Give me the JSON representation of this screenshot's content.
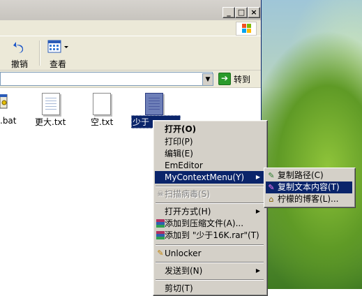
{
  "toolbar": {
    "undo_label": "撤销",
    "view_label": "查看"
  },
  "address": {
    "go_label": "转到"
  },
  "files": [
    {
      "name": ".bat"
    },
    {
      "name": "更大.txt"
    },
    {
      "name": "空.txt"
    },
    {
      "name": "少于"
    }
  ],
  "context_menu": {
    "items": [
      {
        "label": "打开(O)"
      },
      {
        "label": "打印(P)"
      },
      {
        "label": "编辑(E)"
      },
      {
        "label": "EmEditor"
      },
      {
        "label": "MyContextMenu(Y)"
      },
      {
        "label": "扫描病毒(S)"
      },
      {
        "label": "打开方式(H)"
      },
      {
        "label": "添加到压缩文件(A)..."
      },
      {
        "label": "添加到 \"少于16K.rar\"(T)"
      },
      {
        "label": "Unlocker"
      },
      {
        "label": "发送到(N)"
      },
      {
        "label": "剪切(T)"
      }
    ]
  },
  "submenu": {
    "items": [
      {
        "label": "复制路径(C)"
      },
      {
        "label": "复制文本内容(T)"
      },
      {
        "label": "柠檬的博客(L)..."
      }
    ]
  },
  "colors": {
    "selection": "#0a246a",
    "menu_bg": "#d4d0c8",
    "toolbar_bg": "#ece9d8"
  },
  "icons": [
    "minimize-icon",
    "maximize-icon",
    "close-icon",
    "windows-logo-icon",
    "undo-icon",
    "view-icon",
    "dropdown-arrow-icon",
    "go-arrow-icon",
    "document-icon",
    "scan-icon",
    "winrar-icon",
    "unlocker-icon",
    "submenu-arrow-icon",
    "copy-path-icon",
    "copy-text-icon",
    "blog-icon"
  ]
}
